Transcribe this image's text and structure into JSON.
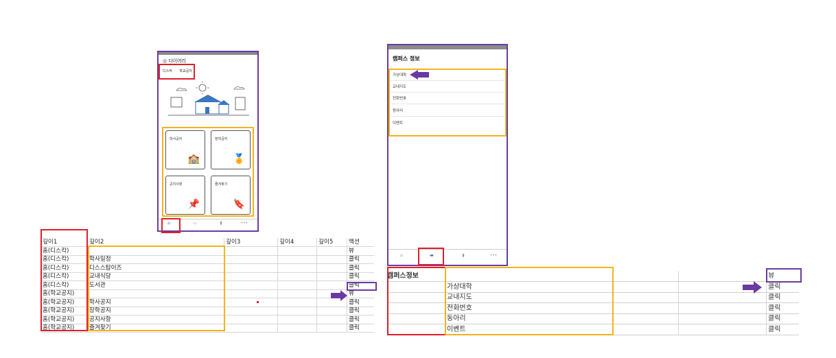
{
  "colors": {
    "red": "#e11d2a",
    "yellow": "#f3b21a",
    "purple": "#6a3aa0"
  },
  "phone_left": {
    "logo": "다이어리",
    "tabs": [
      "디스칵",
      "학교공지"
    ],
    "cards": [
      {
        "label": "학사공지",
        "icon": "school-icon"
      },
      {
        "label": "장학공지",
        "icon": "medal-icon"
      },
      {
        "label": "공지사항",
        "icon": "pin-icon"
      },
      {
        "label": "즐겨찾기",
        "icon": "bookmark-icon"
      }
    ],
    "nav_icons": [
      "home-icon",
      "chat-icon",
      "chart-icon",
      "more-icon"
    ]
  },
  "table_left": {
    "headers": [
      "깊이1",
      "깊이2",
      "깊이3",
      "깊이4",
      "깊이5",
      "액션"
    ],
    "rows": [
      [
        "홈(디스칵)",
        "",
        "뷰"
      ],
      [
        "홈(디스칵)",
        "학사일정",
        "클릭"
      ],
      [
        "홈(디스칵)",
        "디스스탑이즈",
        "클릭"
      ],
      [
        "홈(디스칵)",
        "교내식당",
        "클릭"
      ],
      [
        "홈(디스칵)",
        "도서관",
        "클릭"
      ],
      [
        "홈(학교공지)",
        "",
        "뷰"
      ],
      [
        "홈(학교공지)",
        "학사공지",
        "클릭"
      ],
      [
        "홈(학교공지)",
        "장학공지",
        "클릭"
      ],
      [
        "홈(학교공지)",
        "공지사항",
        "클릭"
      ],
      [
        "홈(학교공지)",
        "즐겨찾기",
        "클릭"
      ]
    ]
  },
  "phone_right": {
    "title": "캠퍼스 정보",
    "menu": [
      "가상대학",
      "교내지도",
      "전화번호",
      "동아리",
      "이벤트"
    ],
    "nav_icons": [
      "home-icon",
      "chat-icon",
      "chart-icon",
      "more-icon"
    ]
  },
  "table_right": {
    "title": "캠퍼스정보",
    "title_action": "뷰",
    "rows": [
      [
        "가상대학",
        "클릭"
      ],
      [
        "교내지도",
        "클릭"
      ],
      [
        "전화번호",
        "클릭"
      ],
      [
        "동아리",
        "클릭"
      ],
      [
        "이벤트",
        "클릭"
      ]
    ]
  }
}
